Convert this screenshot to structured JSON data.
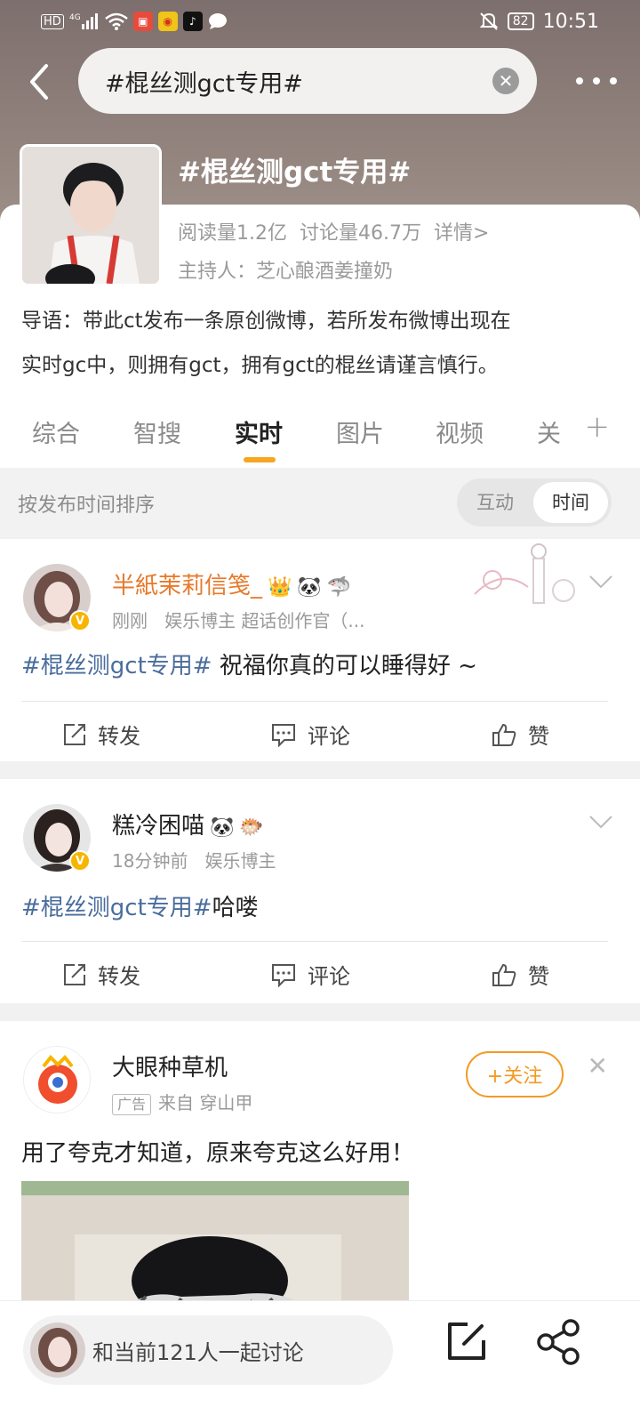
{
  "status_bar": {
    "network": "HD",
    "signal": "4G",
    "battery": "82",
    "time": "10:51"
  },
  "search": {
    "query": "#棍丝测gct专用#"
  },
  "topic": {
    "title": "#棍丝测gct专用#",
    "read_count": "阅读量1.2亿",
    "discussion_count": "讨论量46.7万",
    "details_link": "详情>",
    "host": "主持人：芝心酿酒姜撞奶",
    "intro_line1": "导语：带此ct发布一条原创微博，若所发布微博出现在",
    "intro_line2": "实时gc中，则拥有gct，拥有gct的棍丝请谨言慎行。"
  },
  "tabs": {
    "items": [
      {
        "label": "综合"
      },
      {
        "label": "智搜"
      },
      {
        "label": "实时"
      },
      {
        "label": "图片"
      },
      {
        "label": "视频"
      },
      {
        "label": "关"
      }
    ],
    "active_index": 2,
    "add_label": "+"
  },
  "sort": {
    "label": "按发布时间排序",
    "option_interact": "互动",
    "option_time": "时间"
  },
  "posts": [
    {
      "author": "半紙茉莉信笺_",
      "time": "刚刚",
      "tags": "娱乐博主 超话创作官（...",
      "topic": "#棍丝测gct专用#",
      "content": " 祝福你真的可以睡得好 ~"
    },
    {
      "author": "糕冷困喵",
      "time": "18分钟前",
      "tags": "娱乐博主",
      "topic": "#棍丝测gct专用#",
      "content": "哈喽"
    }
  ],
  "actions": {
    "repost": "转发",
    "comment": "评论",
    "like": "赞"
  },
  "ad": {
    "author": "大眼种草机",
    "badge": "广告",
    "source": "来自 穿山甲",
    "follow": "+关注",
    "content": "用了夸克才知道，原来夸克这么好用！"
  },
  "bottom_bar": {
    "discuss": "和当前121人一起讨论"
  },
  "colors": {
    "accent": "#f6a623",
    "topic_link": "#4a6d9c",
    "author_orange": "#e8792b",
    "follow_orange": "#f39a22"
  }
}
